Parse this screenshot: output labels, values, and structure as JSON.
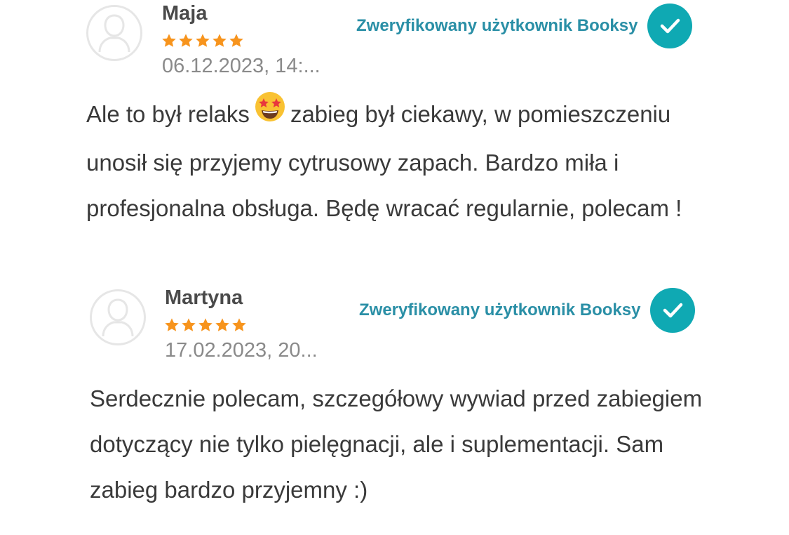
{
  "reviews": [
    {
      "author": "Maja",
      "rating": 5,
      "rating_max": 5,
      "date": "06.12.2023, 14:...",
      "verified_label": "Zweryfikowany użytkownik Booksy",
      "text_before_emoji": "Ale to był relaks",
      "emoji": "star-struck-emoji",
      "text_after_emoji": "zabieg był ciekawy, w pomieszczeniu unosił się przyjemy cytrusowy zapach. Bardzo miła i profesjonalna obsługa. Będę wracać regularnie, polecam !"
    },
    {
      "author": "Martyna",
      "rating": 5,
      "rating_max": 5,
      "date": "17.02.2023, 20...",
      "verified_label": "Zweryfikowany użytkownik Booksy",
      "text": "Serdecznie polecam, szczegółowy wywiad przed zabiegiem dotyczący nie tylko pielęgnacji, ale i suplementacji. Sam zabieg bardzo przyjemny :)"
    }
  ],
  "colors": {
    "star": "#f7941d",
    "verified_text": "#2a8fa6",
    "check_badge": "#0fa9b3",
    "author": "#4a4a4a",
    "date": "#8a8a8a",
    "body": "#3a3a3a"
  },
  "icons": {
    "avatar": "user-silhouette-icon",
    "star": "star-icon",
    "verified": "checkmark-icon"
  }
}
